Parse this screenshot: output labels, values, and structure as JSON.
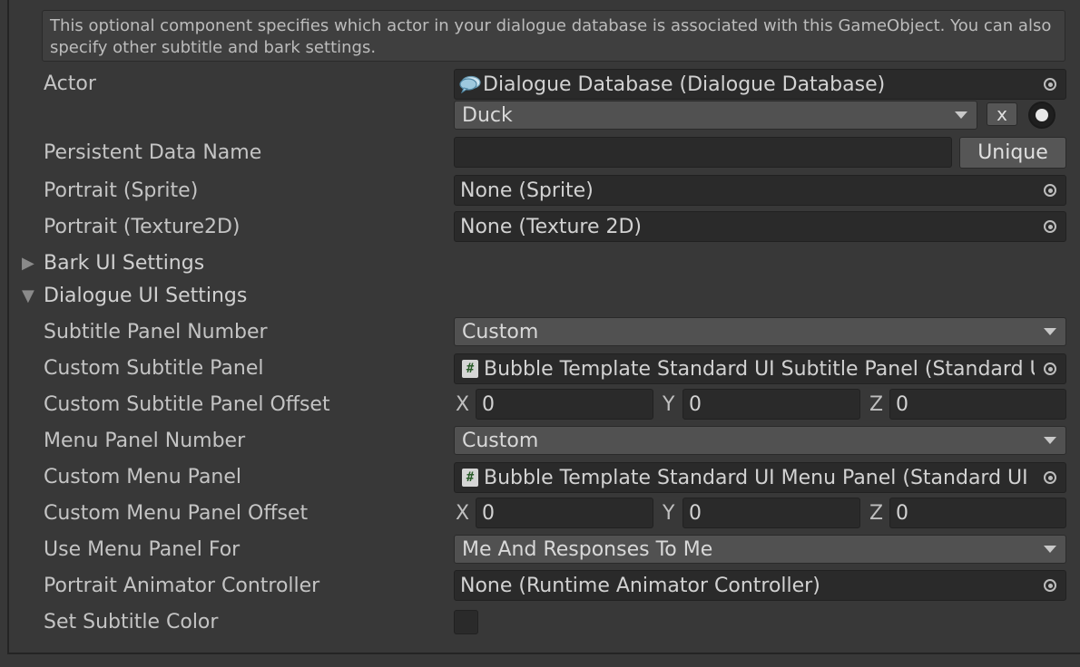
{
  "help": "This optional component specifies which actor in your dialogue database is associated with this GameObject. You can also specify other subtitle and bark settings.",
  "fields": {
    "actor": {
      "label": "Actor",
      "database": "Dialogue Database (Dialogue Database)",
      "selected": "Duck",
      "clear": "x"
    },
    "persistent": {
      "label": "Persistent Data Name",
      "value": "",
      "button": "Unique"
    },
    "portrait_sprite": {
      "label": "Portrait (Sprite)",
      "value": "None (Sprite)"
    },
    "portrait_texture": {
      "label": "Portrait (Texture2D)",
      "value": "None (Texture 2D)"
    },
    "bark_ui": {
      "label": "Bark UI Settings"
    },
    "dialogue_ui": {
      "label": "Dialogue UI Settings"
    },
    "subtitle_panel_number": {
      "label": "Subtitle Panel Number",
      "value": "Custom"
    },
    "custom_subtitle_panel": {
      "label": "Custom Subtitle Panel",
      "value": "Bubble Template Standard UI Subtitle Panel (Standard UI Subtitle Panel)"
    },
    "custom_subtitle_offset": {
      "label": "Custom Subtitle Panel Offset",
      "x": "0",
      "y": "0",
      "z": "0"
    },
    "menu_panel_number": {
      "label": "Menu Panel Number",
      "value": "Custom"
    },
    "custom_menu_panel": {
      "label": "Custom Menu Panel",
      "value": "Bubble Template Standard UI Menu Panel (Standard UI Menu Panel)"
    },
    "custom_menu_offset": {
      "label": "Custom Menu Panel Offset",
      "x": "0",
      "y": "0",
      "z": "0"
    },
    "use_menu_panel_for": {
      "label": "Use Menu Panel For",
      "value": "Me And Responses To Me"
    },
    "portrait_animator": {
      "label": "Portrait Animator Controller",
      "value": "None (Runtime Animator Controller)"
    },
    "set_subtitle_color": {
      "label": "Set Subtitle Color",
      "checked": false
    }
  },
  "axes": {
    "x": "X",
    "y": "Y",
    "z": "Z"
  },
  "icons": {
    "arrow_right": "▶",
    "arrow_down": "▼",
    "script": "#"
  }
}
